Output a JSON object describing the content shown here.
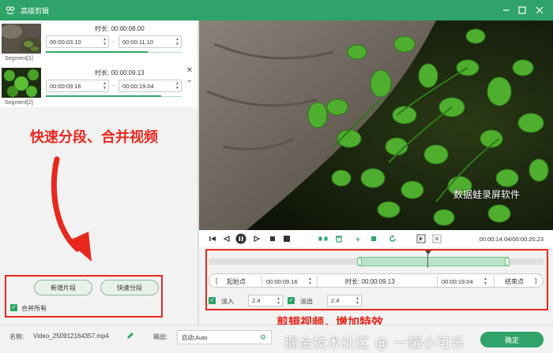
{
  "window": {
    "title": "高级剪辑",
    "logo_icon": "frog-logo-icon",
    "controls": [
      "minimize-icon",
      "maximize-icon",
      "close-icon"
    ]
  },
  "segments": [
    {
      "label": "Segment[1]",
      "duration_label": "时长: 00:00:08.00",
      "start": "00:00:03.10",
      "end": "00:00:11.10",
      "progress": 0.75
    },
    {
      "label": "Segment[2]",
      "duration_label": "时长: 00:00:09.13",
      "start": "00:00:09.16",
      "end": "00:00:19.04",
      "progress": 0.85
    }
  ],
  "annotations": {
    "left": "快速分段、合并视频",
    "bottom": "剪辑视频，增加特效",
    "video_watermark": "数据蛙录屏软件",
    "site_watermark": "掘金技术社区 @ 一罐小可乐"
  },
  "buttons": {
    "add_segment": "新增片段",
    "quick_split": "快速分段",
    "merge_all": "合并所有",
    "ok": "确定"
  },
  "controls": {
    "timecode": "00:00:14.04/00:00:20.23",
    "icons": [
      "prev-frame-icon",
      "rewind-icon",
      "pause-icon",
      "forward-icon",
      "stop-icon",
      "volume-icon",
      "split-icon",
      "delete-icon",
      "add-icon",
      "copy-icon",
      "reset-icon",
      "crop-in-icon",
      "crop-out-icon"
    ]
  },
  "timeline": {
    "start_btn": "起始点",
    "start_time": "00:00:09.16",
    "duration_label": "时长: 00:00:09.13",
    "end_time": "00:00:19.04",
    "end_btn": "结束点",
    "fade_in_label": "淡入",
    "fade_in_value": "2.4",
    "fade_out_label": "淡出",
    "fade_out_value": "2.4"
  },
  "bottom": {
    "name_label": "名称:",
    "name_value": "Video_250912164357.mp4",
    "output_label": "输出:",
    "output_value": "自动;Auto"
  }
}
